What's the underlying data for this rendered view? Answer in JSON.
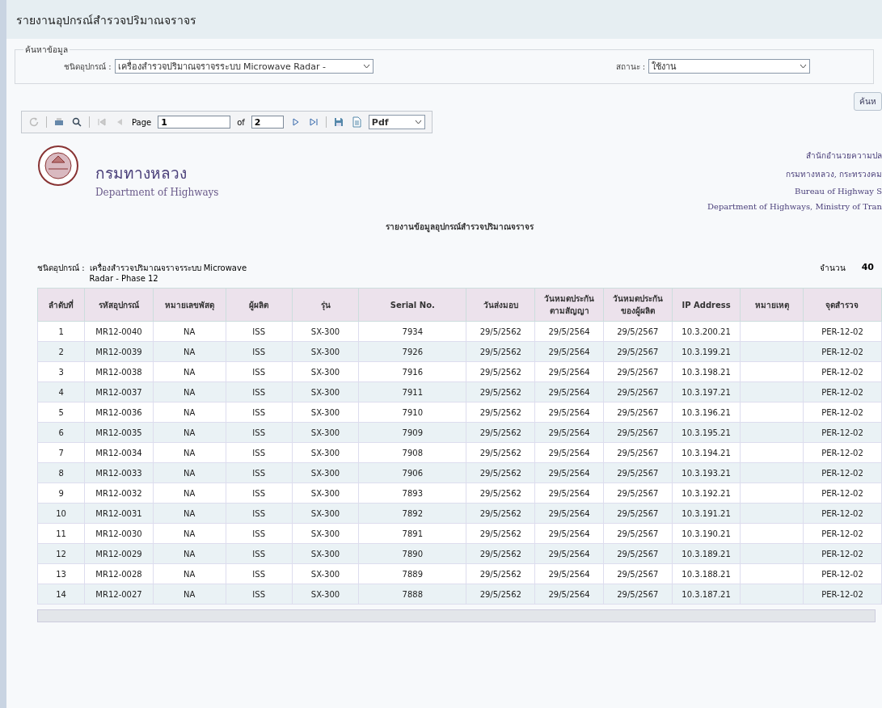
{
  "page_title": "รายงานอุปกรณ์สำรวจปริมาณจราจร",
  "search": {
    "legend": "ค้นหาข้อมูล",
    "device_label": "ชนิดอุปกรณ์ :",
    "device_value": "เครื่องสำรวจปริมาณจราจรระบบ Microwave Radar -",
    "status_label": "สถานะ :",
    "status_value": "ใช้งาน",
    "button": "ค้นห"
  },
  "toolbar": {
    "page_label": "Page",
    "page": "1",
    "of_label": "of",
    "pages": "2",
    "format": "Pdf"
  },
  "report": {
    "org_th": "กรมทางหลวง",
    "org_en": "Department of Highways",
    "right_lines": [
      "สำนักอำนวยความปล",
      "กรมทางหลวง, กระทรวงคม",
      "Bureau of Highway S",
      "Department of Highways, Ministry of Tran"
    ],
    "title": "รายงานข้อมูลอุปกรณ์สำรวจปริมาณจราจร",
    "type_label": "ชนิดอุปกรณ์ :",
    "type_value": "เครื่องสำรวจปริมาณจราจรระบบ Microwave Radar - Phase 12",
    "count_label": "จำนวน",
    "count": "40"
  },
  "table": {
    "columns": [
      "ลำดับที่",
      "รหัสอุปกรณ์",
      "หมายเลขพัสดุ",
      "ผู้ผลิต",
      "รุ่น",
      "Serial No.",
      "วันส่งมอบ",
      "วันหมดประกัน ตามสัญญา",
      "วันหมดประกัน ของผู้ผลิต",
      "IP Address",
      "หมายเหตุ",
      "จุดสำรวจ"
    ],
    "rows": [
      [
        "1",
        "MR12-0040",
        "NA",
        "ISS",
        "SX-300",
        "7934",
        "29/5/2562",
        "29/5/2564",
        "29/5/2567",
        "10.3.200.21",
        "",
        "PER-12-02"
      ],
      [
        "2",
        "MR12-0039",
        "NA",
        "ISS",
        "SX-300",
        "7926",
        "29/5/2562",
        "29/5/2564",
        "29/5/2567",
        "10.3.199.21",
        "",
        "PER-12-02"
      ],
      [
        "3",
        "MR12-0038",
        "NA",
        "ISS",
        "SX-300",
        "7916",
        "29/5/2562",
        "29/5/2564",
        "29/5/2567",
        "10.3.198.21",
        "",
        "PER-12-02"
      ],
      [
        "4",
        "MR12-0037",
        "NA",
        "ISS",
        "SX-300",
        "7911",
        "29/5/2562",
        "29/5/2564",
        "29/5/2567",
        "10.3.197.21",
        "",
        "PER-12-02"
      ],
      [
        "5",
        "MR12-0036",
        "NA",
        "ISS",
        "SX-300",
        "7910",
        "29/5/2562",
        "29/5/2564",
        "29/5/2567",
        "10.3.196.21",
        "",
        "PER-12-02"
      ],
      [
        "6",
        "MR12-0035",
        "NA",
        "ISS",
        "SX-300",
        "7909",
        "29/5/2562",
        "29/5/2564",
        "29/5/2567",
        "10.3.195.21",
        "",
        "PER-12-02"
      ],
      [
        "7",
        "MR12-0034",
        "NA",
        "ISS",
        "SX-300",
        "7908",
        "29/5/2562",
        "29/5/2564",
        "29/5/2567",
        "10.3.194.21",
        "",
        "PER-12-02"
      ],
      [
        "8",
        "MR12-0033",
        "NA",
        "ISS",
        "SX-300",
        "7906",
        "29/5/2562",
        "29/5/2564",
        "29/5/2567",
        "10.3.193.21",
        "",
        "PER-12-02"
      ],
      [
        "9",
        "MR12-0032",
        "NA",
        "ISS",
        "SX-300",
        "7893",
        "29/5/2562",
        "29/5/2564",
        "29/5/2567",
        "10.3.192.21",
        "",
        "PER-12-02"
      ],
      [
        "10",
        "MR12-0031",
        "NA",
        "ISS",
        "SX-300",
        "7892",
        "29/5/2562",
        "29/5/2564",
        "29/5/2567",
        "10.3.191.21",
        "",
        "PER-12-02"
      ],
      [
        "11",
        "MR12-0030",
        "NA",
        "ISS",
        "SX-300",
        "7891",
        "29/5/2562",
        "29/5/2564",
        "29/5/2567",
        "10.3.190.21",
        "",
        "PER-12-02"
      ],
      [
        "12",
        "MR12-0029",
        "NA",
        "ISS",
        "SX-300",
        "7890",
        "29/5/2562",
        "29/5/2564",
        "29/5/2567",
        "10.3.189.21",
        "",
        "PER-12-02"
      ],
      [
        "13",
        "MR12-0028",
        "NA",
        "ISS",
        "SX-300",
        "7889",
        "29/5/2562",
        "29/5/2564",
        "29/5/2567",
        "10.3.188.21",
        "",
        "PER-12-02"
      ],
      [
        "14",
        "MR12-0027",
        "NA",
        "ISS",
        "SX-300",
        "7888",
        "29/5/2562",
        "29/5/2564",
        "29/5/2567",
        "10.3.187.21",
        "",
        "PER-12-02"
      ]
    ]
  }
}
